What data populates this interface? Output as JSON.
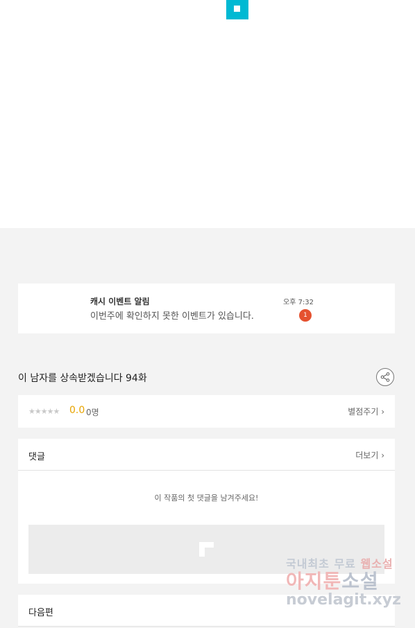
{
  "notice": {
    "title": "캐시 이벤트 알림",
    "message": "이번주에 확인하지 못한 이벤트가 있습니다.",
    "time": "오후 7:32",
    "badge": "1"
  },
  "episode": {
    "title": "이 남자를 상속받겠습니다 94화"
  },
  "rating": {
    "stars": "★★★★★",
    "value": "0.0",
    "count": "0명",
    "rate_link": "별점주기 ›"
  },
  "comments": {
    "title": "댓글",
    "more": "더보기 ›",
    "empty": "이 작품의 첫 댓글을 남겨주세요!"
  },
  "next": {
    "title": "다음편"
  },
  "watermark": {
    "line1_a": "국내최초 무료",
    "line1_b": "웹소설",
    "line2_a": "아지툰",
    "line2_b": "소설",
    "line3": "novelagit.xyz"
  },
  "colors": {
    "accent": "#00b9d3",
    "badge": "#e5512f",
    "rating": "#e8a400"
  }
}
